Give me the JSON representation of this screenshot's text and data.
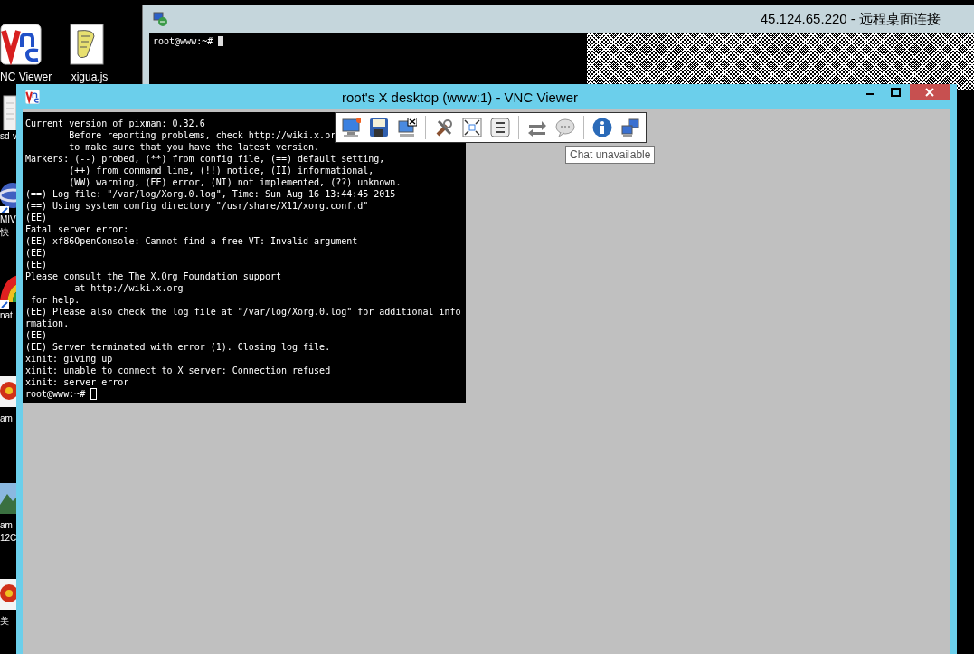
{
  "desktop": {
    "top_icons": [
      {
        "kind": "vnc",
        "label": "NC Viewer"
      },
      {
        "kind": "script",
        "label": "xigua.js"
      }
    ],
    "side_icons": [
      {
        "kind": "document",
        "label": "sd-v"
      },
      {
        "kind": "globe",
        "label": "MIV"
      },
      {
        "kind": "none",
        "label": "快"
      },
      {
        "kind": "rainbow",
        "label": "nat"
      },
      {
        "kind": "flower",
        "label": "am"
      },
      {
        "kind": "landscape",
        "label": "am"
      },
      {
        "kind": "none",
        "label": "12C"
      },
      {
        "kind": "flower",
        "label": "美"
      }
    ]
  },
  "rdp_window": {
    "title": "45.124.65.220 - 远程桌面连接",
    "prompt": "root@www:~# "
  },
  "vnc_window": {
    "title": "root's X desktop (www:1) - VNC Viewer",
    "terminal": {
      "lines": [
        "Current version of pixman: 0.32.6",
        "        Before reporting problems, check http://wiki.x.or",
        "        to make sure that you have the latest version.",
        "Markers: (--) probed, (**) from config file, (==) default setting,",
        "        (++) from command line, (!!) notice, (II) informational,",
        "        (WW) warning, (EE) error, (NI) not implemented, (??) unknown.",
        "(==) Log file: \"/var/log/Xorg.0.log\", Time: Sun Aug 16 13:44:45 2015",
        "(==) Using system config directory \"/usr/share/X11/xorg.conf.d\"",
        "(EE)",
        "Fatal server error:",
        "(EE) xf86OpenConsole: Cannot find a free VT: Invalid argument",
        "(EE)",
        "(EE)",
        "Please consult the The X.Org Foundation support",
        "         at http://wiki.x.org",
        " for help.",
        "(EE) Please also check the log file at \"/var/log/Xorg.0.log\" for additional info",
        "rmation.",
        "(EE)",
        "(EE) Server terminated with error (1). Closing log file.",
        "xinit: giving up",
        "xinit: unable to connect to X server: Connection refused",
        "xinit: server error"
      ],
      "prompt": "root@www:~# "
    },
    "toolbar": {
      "groups": [
        [
          {
            "kind": "new"
          },
          {
            "kind": "save"
          },
          {
            "kind": "close"
          }
        ],
        [
          {
            "kind": "options"
          },
          {
            "kind": "fullscreen"
          },
          {
            "kind": "ctrlaltdel"
          }
        ],
        [
          {
            "kind": "transfer"
          },
          {
            "kind": "chat"
          }
        ],
        [
          {
            "kind": "info"
          },
          {
            "kind": "connections"
          }
        ]
      ]
    },
    "tooltip": "Chat unavailable"
  }
}
